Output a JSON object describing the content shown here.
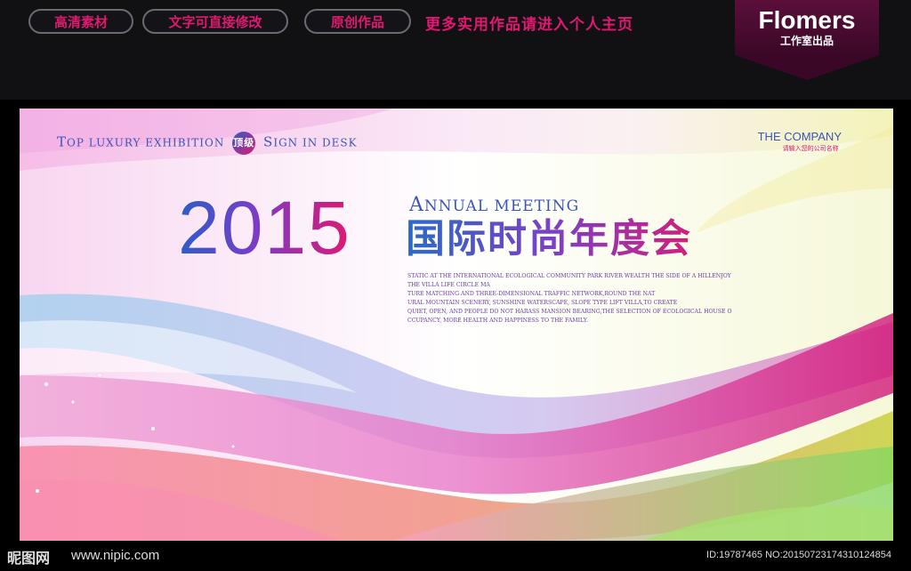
{
  "top_bar": {
    "pills": [
      "高清素材",
      "文字可直接修改",
      "原创作品"
    ],
    "promo_text": "更多实用作品请进入个人主页",
    "brand_name": "Flomers",
    "brand_sub": "工作室出品"
  },
  "banner": {
    "tagline_parts": [
      "T",
      "OP ",
      "LUXURY EXHIBITION",
      "顶级",
      "S",
      "IGN IN DESK"
    ],
    "company_name": "THE COMPANY",
    "company_sub": "请输入您的公司名称",
    "year": "2015",
    "annual_a": "A",
    "annual_rest": "NNUAL MEETING",
    "title_cn": "国际时尚年度会",
    "description_lines": [
      "STATIC AT THE INTERNATIONAL ECOLOGICAL COMMUNITY PARK RIVER WEALTH THE SIDE OF A HILLENJOY",
      "THE VILLA LIFE CIRCLE MA",
      "TURE MATCHING AND THREE-DIMENSIONAL TRAFFIC NETWORK,ROUND THE NAT",
      "URAL MOUNTAIN SCENERY, SUNSHINE WATERSCAPE, SLOPE TYPE LIFT VILLA,TO CREATE",
      "QUIET, OPEN, AND PEOPLE DO NOT HARASS MANSION BEARING,THE SELECTION OF ECOLOGICAL HOUSE O",
      "CCUPANCY, MORE HEALTH AND HAPPINESS TO THE FAMILY."
    ]
  },
  "footer": {
    "logo_text": "昵图网",
    "url": "www.nipic.com",
    "id_text": "ID:19787465 NO:20150723174310124854"
  },
  "colors": {
    "accent_pink": "#e0186f",
    "accent_blue": "#2a5ec8",
    "background": "#111114"
  }
}
